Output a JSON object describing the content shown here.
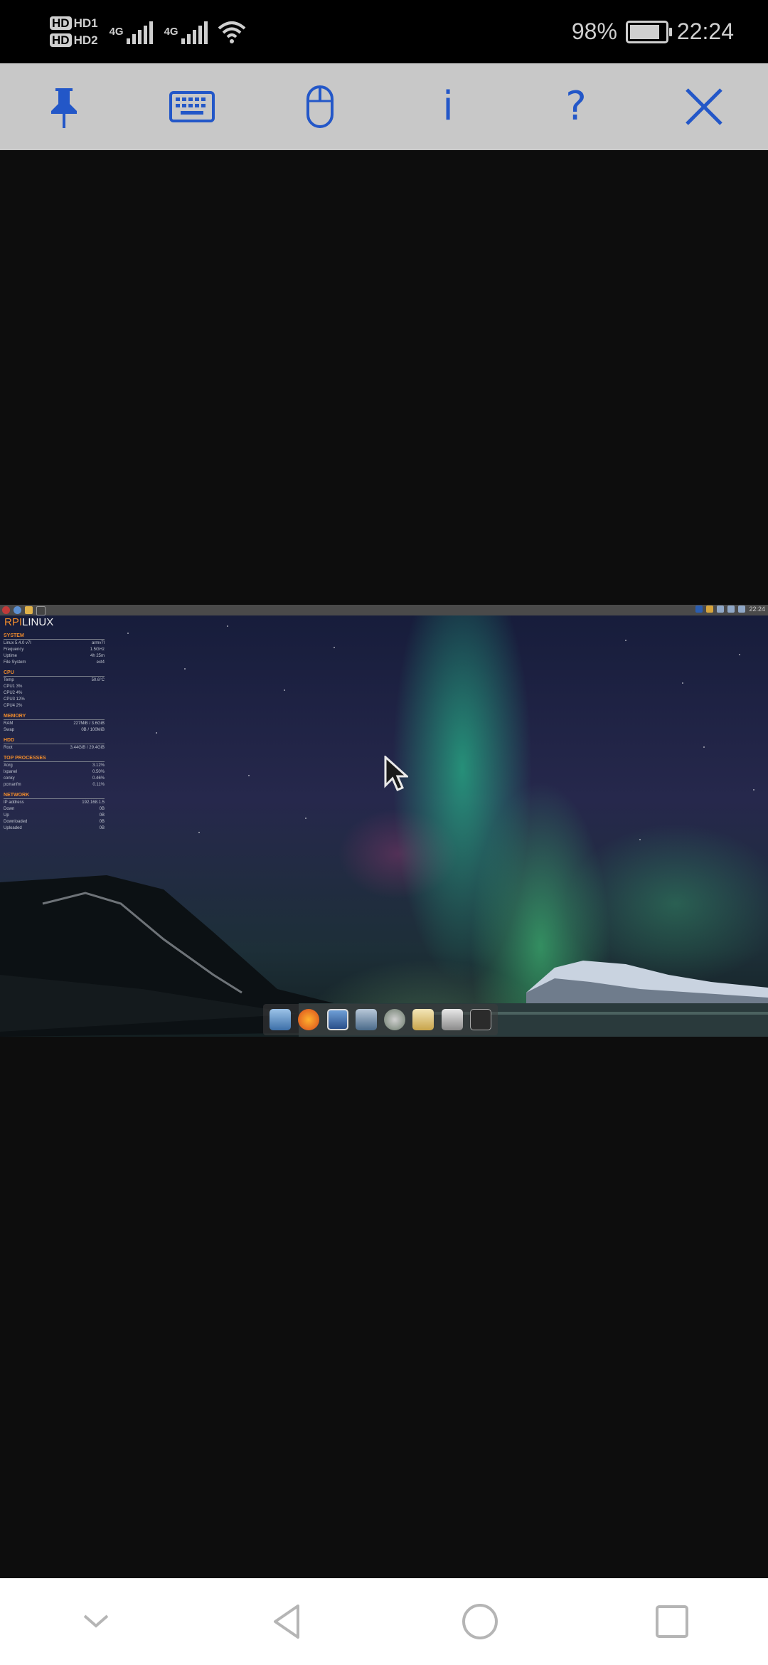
{
  "status_bar": {
    "sim1": "HD1",
    "sim2": "HD2",
    "network1": "4G",
    "network2": "4G",
    "battery": "98%",
    "battery_level": 0.98,
    "time": "22:24"
  },
  "toolbar": {
    "items": [
      "pin-icon",
      "keyboard-icon",
      "mouse-icon",
      "info-icon",
      "help-icon",
      "close-icon"
    ],
    "info_label": "i",
    "help_label": "?",
    "accent_color": "#2357c8"
  },
  "remote_desktop": {
    "logo_part1": "RPI",
    "logo_part2": "LINUX",
    "panel_clock": "22:24",
    "conky": [
      {
        "title": "SYSTEM",
        "rows": [
          [
            "Linux 5.4.0 v7l",
            "armv7l"
          ],
          [
            "Frequency",
            "1.5GHz"
          ],
          [
            "Uptime",
            "4h 25m"
          ],
          [
            "File System",
            "ext4"
          ]
        ]
      },
      {
        "title": "CPU",
        "rows": [
          [
            "Temp",
            "50.6°C"
          ],
          [
            "CPU1 3%",
            ""
          ],
          [
            "CPU2 4%",
            ""
          ],
          [
            "CPU3 12%",
            ""
          ],
          [
            "CPU4 2%",
            ""
          ]
        ]
      },
      {
        "title": "MEMORY",
        "rows": [
          [
            "RAM",
            "227MiB / 3.6GiB"
          ],
          [
            "Swap",
            "0B / 100MiB"
          ]
        ]
      },
      {
        "title": "HDD",
        "rows": [
          [
            "Root",
            "3.44GiB / 29.4GiB"
          ]
        ]
      },
      {
        "title": "TOP PROCESSES",
        "rows": [
          [
            "Xorg",
            "3.12%"
          ],
          [
            "lxpanel",
            "0.50%"
          ],
          [
            "conky",
            "0.46%"
          ],
          [
            "pcmanfm",
            "0.11%"
          ]
        ]
      },
      {
        "title": "NETWORK",
        "rows": [
          [
            "IP address",
            "192.168.1.5"
          ],
          [
            "Down",
            "0B"
          ],
          [
            "Up",
            "0B"
          ],
          [
            "Downloaded",
            "0B"
          ],
          [
            "Uploaded",
            "0B"
          ]
        ]
      }
    ]
  },
  "nav_bar": {
    "items": [
      "collapse-icon",
      "back-icon",
      "home-icon",
      "recents-icon"
    ]
  }
}
